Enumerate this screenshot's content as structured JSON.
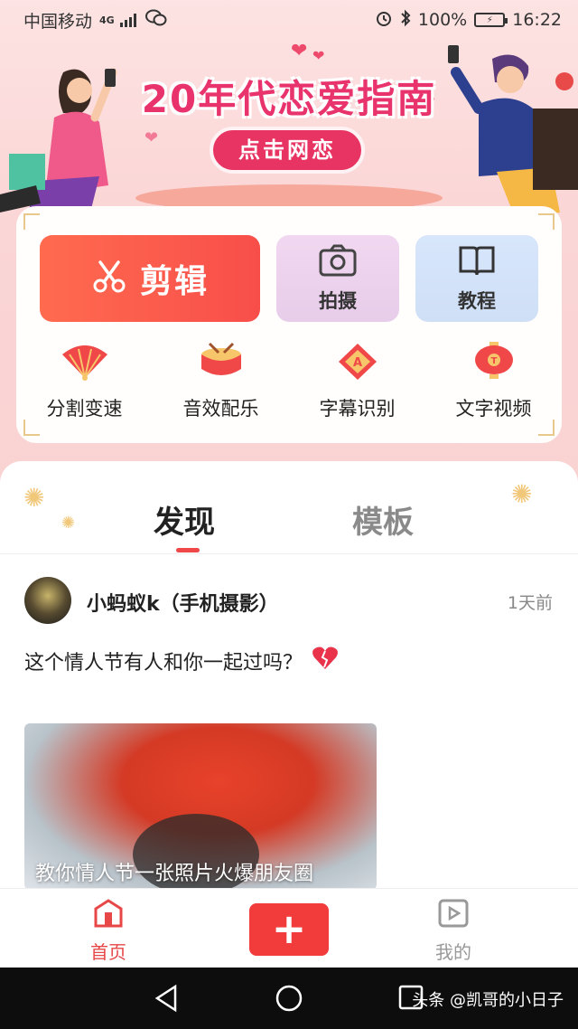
{
  "status_bar": {
    "carrier": "中国移动",
    "network": "4G",
    "battery": "100%",
    "time": "16:22"
  },
  "banner": {
    "title": "20年代恋爱指南",
    "button": "点击网恋"
  },
  "tools": {
    "edit": "剪辑",
    "shoot": "拍摄",
    "tutorial": "教程",
    "functions": [
      {
        "label": "分割变速",
        "icon": "fan-icon"
      },
      {
        "label": "音效配乐",
        "icon": "drum-icon"
      },
      {
        "label": "字幕识别",
        "icon": "subtitle-icon"
      },
      {
        "label": "文字视频",
        "icon": "lantern-icon"
      }
    ]
  },
  "tabs": {
    "discover": "发现",
    "template": "模板"
  },
  "post": {
    "author": "小蚂蚁k（手机摄影）",
    "time": "1天前",
    "text": "这个情人节有人和你一起过吗？",
    "thumbnail_caption": "教你情人节一张照片火爆朋友圈"
  },
  "bottom_nav": {
    "home": "首页",
    "mine": "我的"
  },
  "watermark": "头条 @凯哥的小日子",
  "colors": {
    "accent": "#f04848",
    "banner_title": "#e8336d",
    "banner_bg": "#fbd6d6"
  }
}
